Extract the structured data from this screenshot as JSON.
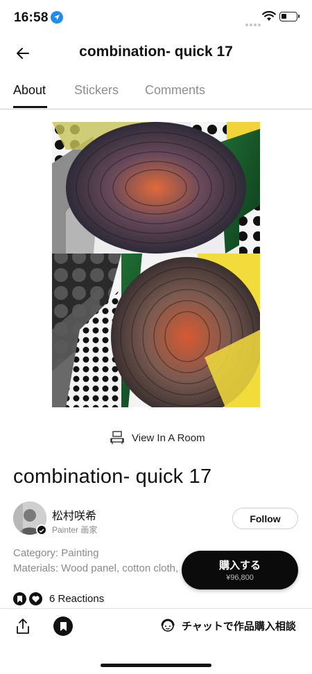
{
  "status": {
    "time": "16:58"
  },
  "nav": {
    "title": "combination- quick 17",
    "back_icon": "arrow-left-icon"
  },
  "tabs": [
    {
      "label": "About",
      "active": true
    },
    {
      "label": "Stickers",
      "active": false
    },
    {
      "label": "Comments",
      "active": false
    }
  ],
  "artwork": {
    "view_in_room": "View In A Room"
  },
  "title": "combination- quick 17",
  "artist": {
    "name": "松村咲希",
    "role": "Painter 画家"
  },
  "follow_label": "Follow",
  "meta": {
    "category": "Category: Painting",
    "materials": "Materials: Wood panel, cotton cloth,"
  },
  "reactions": {
    "label": "6 Reactions"
  },
  "buy": {
    "label": "購入する",
    "price": "¥96,800"
  },
  "bottom": {
    "chat_label": "チャットで作品購入相談"
  },
  "colors": {
    "accent": "#0b0b0b",
    "location_icon": "#1e8cf0",
    "muted": "#8a8a8a"
  }
}
